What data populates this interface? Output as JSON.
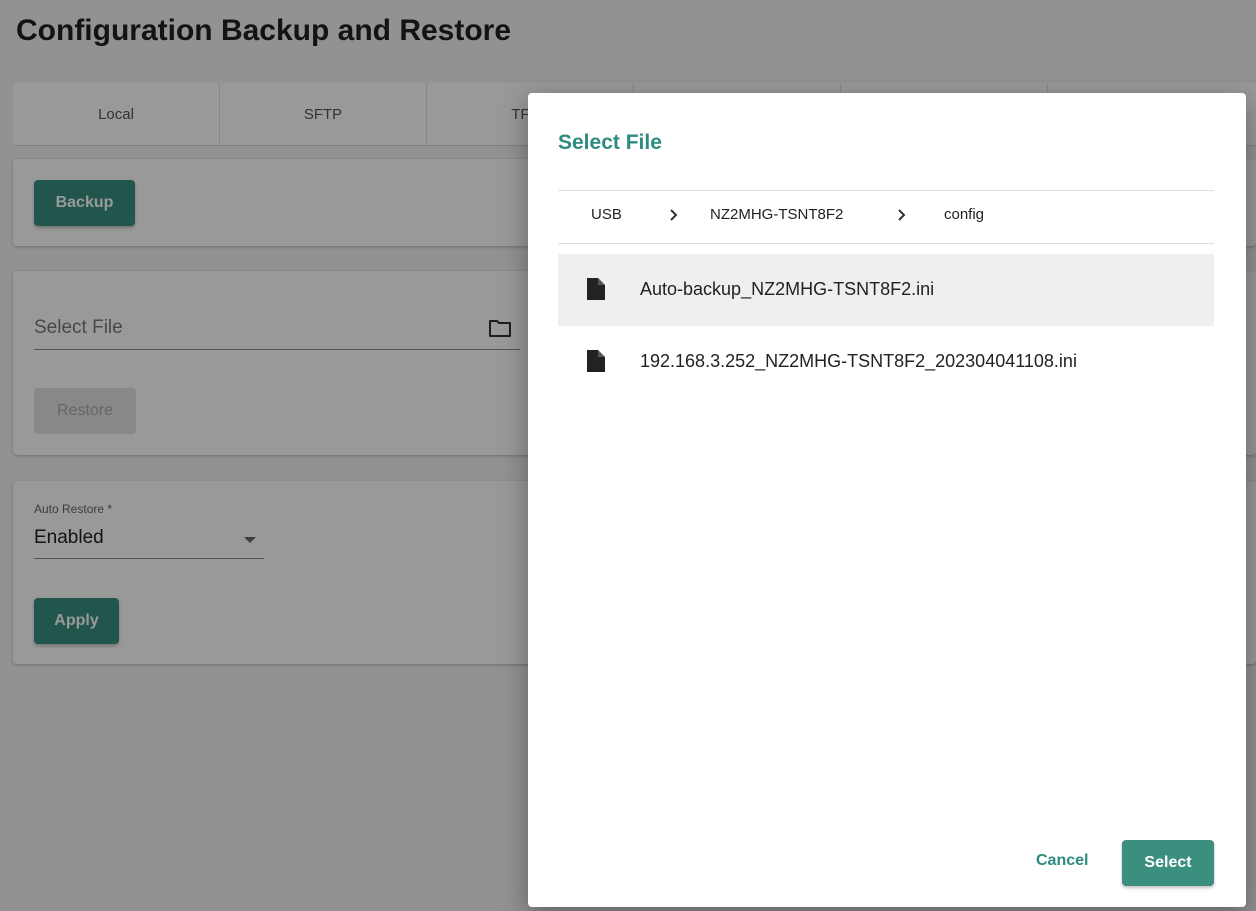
{
  "page": {
    "title": "Configuration Backup and Restore"
  },
  "tabs": [
    "Local",
    "SFTP",
    "TFTP",
    "",
    "",
    ""
  ],
  "backup": {
    "button_label": "Backup"
  },
  "restore": {
    "select_file_placeholder": "Select File",
    "folder_icon": "folder-icon",
    "button_label": "Restore"
  },
  "auto_restore": {
    "label": "Auto Restore *",
    "value": "Enabled",
    "apply_label": "Apply"
  },
  "dialog": {
    "title": "Select File",
    "breadcrumb": [
      "USB",
      "NZ2MHG-TSNT8F2",
      "config"
    ],
    "files": [
      {
        "name": "Auto-backup_NZ2MHG-TSNT8F2.ini",
        "icon": "file-icon",
        "highlighted": true
      },
      {
        "name": "192.168.3.252_NZ2MHG-TSNT8F2_202304041108.ini",
        "icon": "file-icon",
        "highlighted": false
      }
    ],
    "cancel_label": "Cancel",
    "select_label": "Select"
  },
  "colors": {
    "accent": "#3a8f7f",
    "title_teal": "#2e8b80",
    "overlay": "rgba(0,0,0,0.40)"
  }
}
